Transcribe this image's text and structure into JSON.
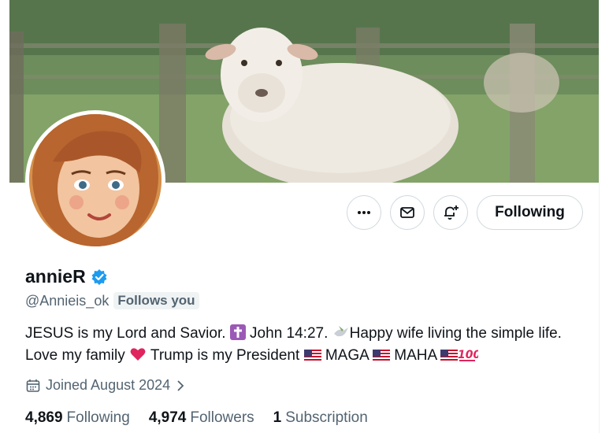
{
  "profile": {
    "display_name": "annieR",
    "handle": "@Annieis_ok",
    "follows_you": "Follows you",
    "verified": true,
    "bio": {
      "part1": "JESUS is my Lord and Savior. ",
      "part2": " John 14:27. ",
      "part3": "Happy wife living the simple life. Love my family ",
      "part4": " Trump is my President ",
      "part5": " MAGA ",
      "part6": " MAHA "
    },
    "joined": "Joined August 2024"
  },
  "actions": {
    "more_icon": "more-icon",
    "message_icon": "envelope-icon",
    "notify_icon": "bell-plus-icon",
    "follow_label": "Following"
  },
  "stats": {
    "following_count": "4,869",
    "following_label": "Following",
    "followers_count": "4,974",
    "followers_label": "Followers",
    "subscriptions_count": "1",
    "subscriptions_label": "Subscription"
  },
  "colors": {
    "verified_blue": "#1d9bf0",
    "text_primary": "#0f1419",
    "text_secondary": "#536471",
    "border": "#cfd9de"
  }
}
